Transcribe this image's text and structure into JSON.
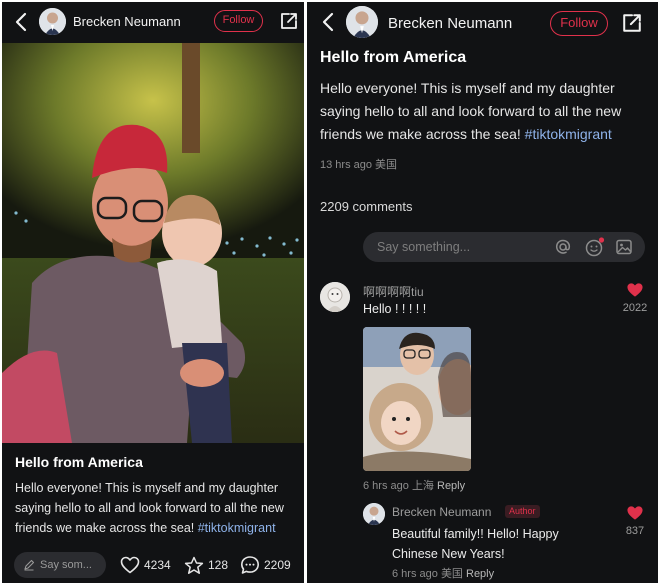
{
  "post": {
    "author": "Brecken Neumann",
    "follow_label": "Follow",
    "title": "Hello from America",
    "body": "Hello everyone! This is myself and my daughter saying hello to all and look forward to all the new friends we make across the sea!",
    "hashtag": "#tiktokmigrant",
    "time": "13 hrs ago",
    "location": "美国"
  },
  "actions": {
    "say_placeholder": "Say som...",
    "likes": "4234",
    "favorites": "128",
    "comments": "2209"
  },
  "comments_section": {
    "count_label": "2209 comments",
    "input_placeholder": "Say something...",
    "comments": [
      {
        "user": "啊啊啊啊tiu",
        "text": "Hello ! ! ! ! !",
        "likes": "2022",
        "time": "6 hrs ago",
        "location": "上海",
        "reply_label": "Reply"
      },
      {
        "user": "Brecken Neumann",
        "badge": "Author",
        "text": "Beautiful family!! Hello! Happy Chinese New Years!",
        "likes": "837",
        "time": "6 hrs ago",
        "location": "美国",
        "reply_label": "Reply"
      }
    ]
  },
  "icons": {
    "back": "back-arrow-icon",
    "share": "share-icon",
    "pencil": "pencil-icon",
    "heart": "heart-icon",
    "star": "star-icon",
    "comment": "comment-bubble-icon",
    "mention": "at-mention-icon",
    "emoji": "emoji-icon",
    "image": "image-icon"
  },
  "colors": {
    "background": "#111214",
    "accent": "#e0314b",
    "hashtag": "#8fb3ea"
  }
}
